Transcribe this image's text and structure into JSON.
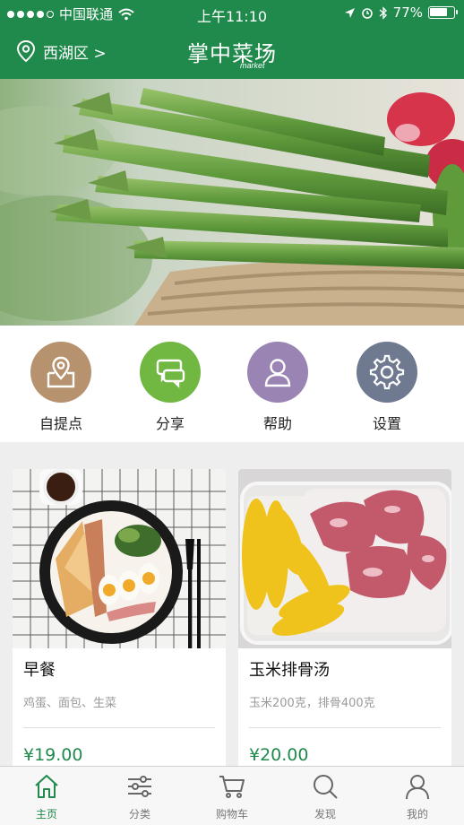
{
  "status": {
    "carrier": "中国联通",
    "time": "上午11:10",
    "battery": "77%",
    "battery_level": 0.77
  },
  "header": {
    "location": "西湖区 >",
    "brand": "掌中菜场",
    "brand_sub": "market"
  },
  "banner": {
    "pages": 3,
    "active_page": 1
  },
  "quick": [
    {
      "label": "自提点",
      "color": "#b6926f",
      "icon": "map-pin-icon"
    },
    {
      "label": "分享",
      "color": "#71b843",
      "icon": "chat-bubbles-icon"
    },
    {
      "label": "帮助",
      "color": "#9a84b4",
      "icon": "person-icon"
    },
    {
      "label": "设置",
      "color": "#6f7990",
      "icon": "gear-icon"
    }
  ],
  "products": [
    {
      "name": "早餐",
      "desc": "鸡蛋、面包、生菜",
      "price": "¥19.00"
    },
    {
      "name": "玉米排骨汤",
      "desc": "玉米200克，排骨400克",
      "price": "¥20.00"
    }
  ],
  "tabs": [
    {
      "label": "主页",
      "icon": "home-icon",
      "active": true
    },
    {
      "label": "分类",
      "icon": "sliders-icon",
      "active": false
    },
    {
      "label": "购物车",
      "icon": "cart-icon",
      "active": false
    },
    {
      "label": "发现",
      "icon": "search-icon",
      "active": false
    },
    {
      "label": "我的",
      "icon": "user-icon",
      "active": false
    }
  ],
  "colors": {
    "brand": "#1f8a4c",
    "tab_inactive": "#777777"
  }
}
